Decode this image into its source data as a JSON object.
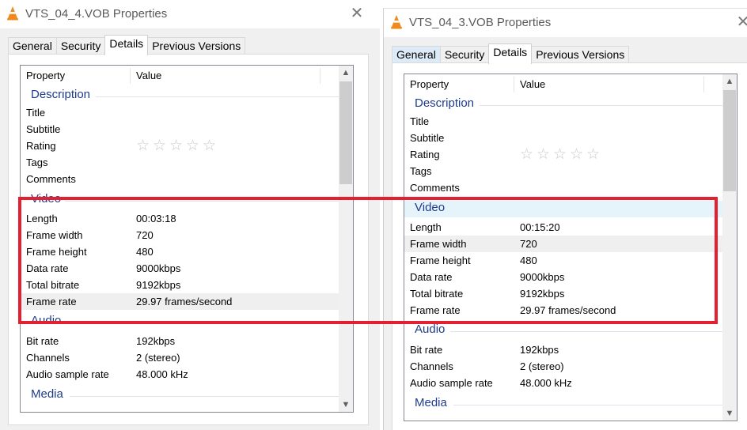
{
  "colors": {
    "annotation": "#e32030",
    "group_label": "#1e3c8c"
  },
  "annotation": {
    "shape": "rectangle",
    "color": "#e32030"
  },
  "windows": [
    {
      "title": "VTS_04_4.VOB Properties",
      "app_icon": "vlc-cone-icon",
      "close_glyph": "✕",
      "tabs": [
        "General",
        "Security",
        "Details",
        "Previous Versions"
      ],
      "selected_tab": "Details",
      "header": {
        "property": "Property",
        "value": "Value"
      },
      "groups": {
        "description": {
          "label": "Description",
          "rows": [
            {
              "k": "Title",
              "v": ""
            },
            {
              "k": "Subtitle",
              "v": ""
            },
            {
              "k": "Rating",
              "v": ""
            },
            {
              "k": "Tags",
              "v": ""
            },
            {
              "k": "Comments",
              "v": ""
            }
          ]
        },
        "video": {
          "label": "Video",
          "rows": [
            {
              "k": "Length",
              "v": "00:03:18"
            },
            {
              "k": "Frame width",
              "v": "720"
            },
            {
              "k": "Frame height",
              "v": "480"
            },
            {
              "k": "Data rate",
              "v": "9000kbps"
            },
            {
              "k": "Total bitrate",
              "v": "9192kbps"
            },
            {
              "k": "Frame rate",
              "v": "29.97 frames/second"
            }
          ]
        },
        "audio": {
          "label": "Audio",
          "rows": [
            {
              "k": "Bit rate",
              "v": "192kbps"
            },
            {
              "k": "Channels",
              "v": "2 (stereo)"
            },
            {
              "k": "Audio sample rate",
              "v": "48.000 kHz"
            }
          ]
        },
        "media": {
          "label": "Media"
        }
      },
      "rating_stars": 0
    },
    {
      "title": "VTS_04_3.VOB Properties",
      "app_icon": "vlc-cone-icon",
      "close_glyph": "✕",
      "tabs": [
        "General",
        "Security",
        "Details",
        "Previous Versions"
      ],
      "selected_tab": "Details",
      "header": {
        "property": "Property",
        "value": "Value"
      },
      "groups": {
        "description": {
          "label": "Description",
          "rows": [
            {
              "k": "Title",
              "v": ""
            },
            {
              "k": "Subtitle",
              "v": ""
            },
            {
              "k": "Rating",
              "v": ""
            },
            {
              "k": "Tags",
              "v": ""
            },
            {
              "k": "Comments",
              "v": ""
            }
          ]
        },
        "video": {
          "label": "Video",
          "rows": [
            {
              "k": "Length",
              "v": "00:15:20"
            },
            {
              "k": "Frame width",
              "v": "720"
            },
            {
              "k": "Frame height",
              "v": "480"
            },
            {
              "k": "Data rate",
              "v": "9000kbps"
            },
            {
              "k": "Total bitrate",
              "v": "9192kbps"
            },
            {
              "k": "Frame rate",
              "v": "29.97 frames/second"
            }
          ]
        },
        "audio": {
          "label": "Audio",
          "rows": [
            {
              "k": "Bit rate",
              "v": "192kbps"
            },
            {
              "k": "Channels",
              "v": "2 (stereo)"
            },
            {
              "k": "Audio sample rate",
              "v": "48.000 kHz"
            }
          ]
        },
        "media": {
          "label": "Media"
        }
      },
      "rating_stars": 0
    }
  ]
}
